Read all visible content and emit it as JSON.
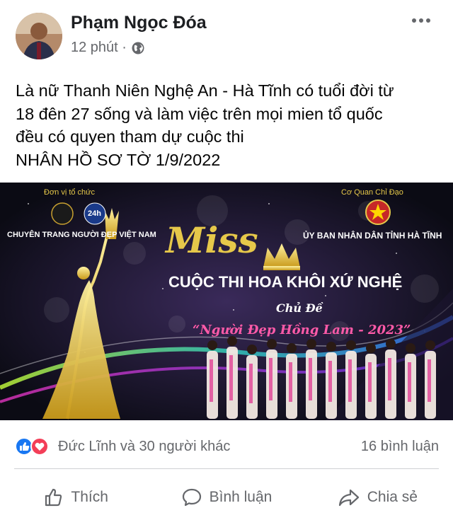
{
  "post": {
    "author": "Phạm Ngọc Đóa",
    "time": "12 phút ·",
    "audience_icon": "globe-icon",
    "text_lines": [
      "Là nữ Thanh Niên Nghệ An - Hà Tĩnh có tuổi đời từ",
      "18 đên 27 sống và làm việc trên mọi mien tổ quốc",
      "đều có quyen tham dự cuộc thi",
      "NHÂN HỒ SƠ TỜ 1/9/2022"
    ]
  },
  "banner": {
    "organizer_label": "Đơn vị tổ chức",
    "organizer_name": "CHUYÊN TRANG NGƯỜI ĐẸP VIỆT NAM",
    "logo2_text": "24h",
    "director_label": "Cơ Quan Chỉ Đạo",
    "director_name": "ỦY BAN NHÂN DÂN TỈNH HÀ TĨNH",
    "miss_text": "Miss",
    "contest_title": "CUỘC THI HOA KHÔI XỨ NGHỆ",
    "theme_label": "Chủ Đề",
    "theme_title": "“Người Đẹp Hồng Lam - 2023”"
  },
  "reactions": {
    "summary": "Đức Lĩnh và 30 người khác",
    "comments": "16 bình luận",
    "icons": [
      "like-icon",
      "love-icon"
    ],
    "like_color": "#1877f2",
    "love_color": "#f33e58"
  },
  "actions": {
    "like": "Thích",
    "comment": "Bình luận",
    "share": "Chia sẻ"
  },
  "colors": {
    "gold": "#e6c84a",
    "banner_bg": "#0b0b14",
    "muted": "#65676b"
  }
}
